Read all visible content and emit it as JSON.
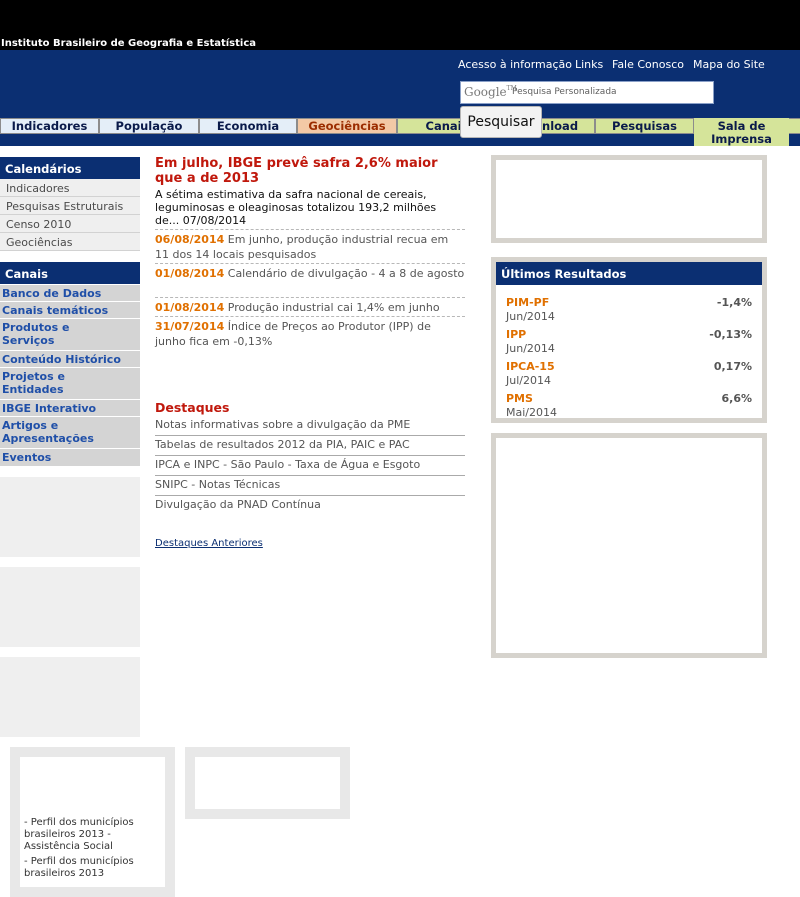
{
  "header": {
    "org_name": "Instituto Brasileiro de Geografia e Estatística",
    "links": [
      "Acesso à informação",
      "Links",
      "Fale Conosco",
      "Mapa do Site"
    ],
    "search": {
      "google_label": "Google",
      "google_tm": "TM",
      "label": "Pesquisa Personalizada",
      "button": "Pesquisar"
    }
  },
  "tabs": [
    "Indicadores",
    "População",
    "Economia",
    "Geociências",
    "Canais",
    "Download",
    "Pesquisas",
    "Sala de Imprensa"
  ],
  "sidebar": {
    "calendarios_title": "Calendários",
    "calendarios": [
      "Indicadores",
      "Pesquisas Estruturais",
      "Censo 2010",
      "Geociências"
    ],
    "canais_title": "Canais",
    "canais": [
      "Banco de Dados",
      "Canais temáticos",
      "Produtos e Serviços",
      "Conteúdo Histórico",
      "Projetos e Entidades",
      "IBGE Interativo",
      "Artigos e Apresentações",
      "Eventos"
    ]
  },
  "main": {
    "headline": "Em julho, IBGE prevê safra 2,6% maior que a de 2013",
    "lead": "A sétima estimativa da safra nacional de cereais, leguminosas e oleaginosas totalizou 193,2 milhões de... 07/08/2014",
    "news": [
      {
        "date": "06/08/2014",
        "text": " Em junho, produção industrial recua em 11 dos 14 locais pesquisados"
      },
      {
        "date": "01/08/2014",
        "text": " Calendário de divulgação - 4 a 8 de agosto"
      },
      {
        "date": "01/08/2014",
        "text": " Produção industrial cai 1,4% em junho"
      },
      {
        "date": "31/07/2014",
        "text": " Índice de Preços ao Produtor (IPP) de junho fica em -0,13%"
      }
    ],
    "destaques_title": "Destaques",
    "destaques": [
      "Notas informativas sobre a divulgação da PME",
      "Tabelas de resultados 2012 da PIA, PAIC e PAC",
      "IPCA e INPC - São Paulo - Taxa de Água e Esgoto",
      "SNIPC - Notas Técnicas",
      "Divulgação da PNAD Contínua"
    ],
    "destaques_anteriores": "Destaques Anteriores"
  },
  "results": {
    "title": "Últimos Resultados",
    "items": [
      {
        "name": "PIM-PF",
        "date": "Jun/2014",
        "value": "-1,4%"
      },
      {
        "name": "IPP",
        "date": "Jun/2014",
        "value": "-0,13%"
      },
      {
        "name": "IPCA-15",
        "date": "Jul/2014",
        "value": "0,17%"
      },
      {
        "name": "PMS",
        "date": "Mai/2014",
        "value": "6,6%"
      }
    ]
  },
  "bottom": {
    "perfil_links": [
      "- Perfil dos municípios brasileiros 2013 - Assistência Social",
      "- Perfil dos municípios brasileiros 2013"
    ]
  },
  "colors": {
    "header_blue": "#0b2f72",
    "headline_red": "#c0180c",
    "date_orange": "#e07000",
    "link_blue": "#1f4fa8"
  }
}
